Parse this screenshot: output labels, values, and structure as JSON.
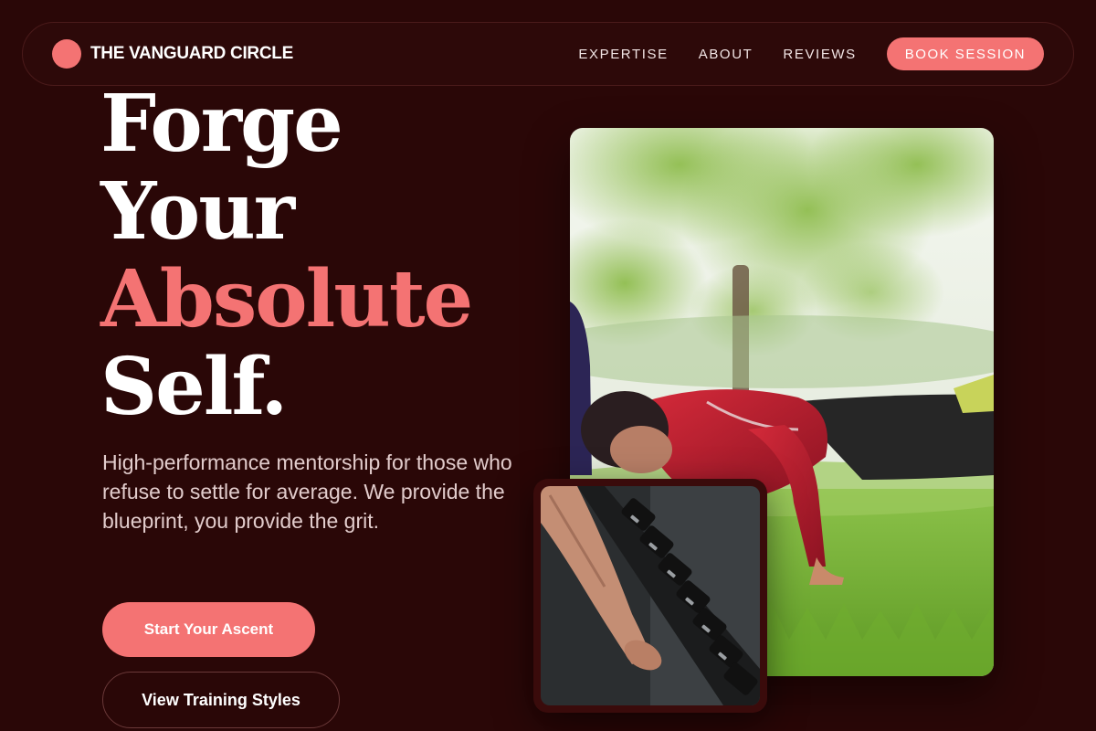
{
  "nav": {
    "brand": "THE VANGUARD CIRCLE",
    "links": [
      "EXPERTISE",
      "ABOUT",
      "REVIEWS"
    ],
    "cta": "BOOK SESSION"
  },
  "hero": {
    "headline": [
      "Forge",
      "Your",
      "Absolute",
      "Self."
    ],
    "subtitle": "High-performance mentorship for those who refuse to settle for average. We provide the blueprint, you provide the grit.",
    "primary_button": "Start Your Ascent",
    "secondary_button": "View Training Styles"
  },
  "images": {
    "main": "man-doing-pushups-outdoors-photo",
    "secondary": "hand-gripping-dumbbell-rack-photo",
    "watermark": "hailmework"
  },
  "colors": {
    "background": "#2a0707",
    "accent": "#f47373",
    "text": "#ffffff"
  }
}
